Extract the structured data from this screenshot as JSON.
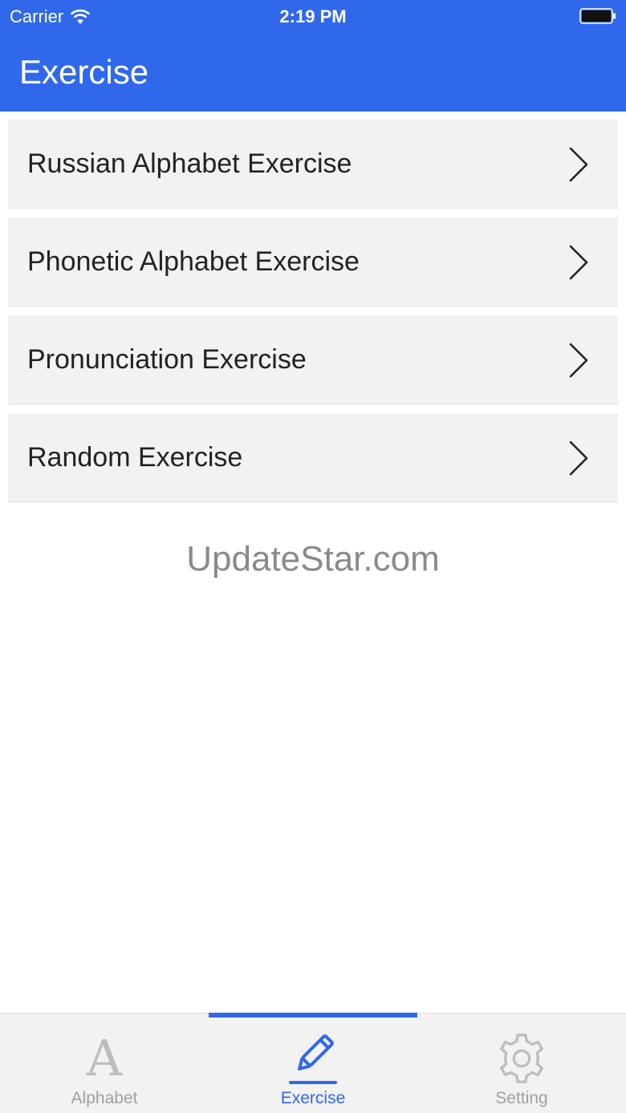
{
  "status_bar": {
    "carrier": "Carrier",
    "time": "2:19 PM"
  },
  "header": {
    "title": "Exercise",
    "background_color": "#3068eb"
  },
  "exercise_list": {
    "items": [
      {
        "label": "Russian Alphabet Exercise"
      },
      {
        "label": "Phonetic Alphabet Exercise"
      },
      {
        "label": "Pronunciation Exercise"
      },
      {
        "label": "Random Exercise"
      }
    ]
  },
  "watermark": "UpdateStar.com",
  "tab_bar": {
    "active_color": "#3068eb",
    "inactive_color": "#a0a0a0",
    "tabs": [
      {
        "label": "Alphabet",
        "icon": "letter-a-icon",
        "glyph": "A",
        "active": false
      },
      {
        "label": "Exercise",
        "icon": "pencil-icon",
        "active": true
      },
      {
        "label": "Setting",
        "icon": "gear-icon",
        "active": false
      }
    ]
  }
}
